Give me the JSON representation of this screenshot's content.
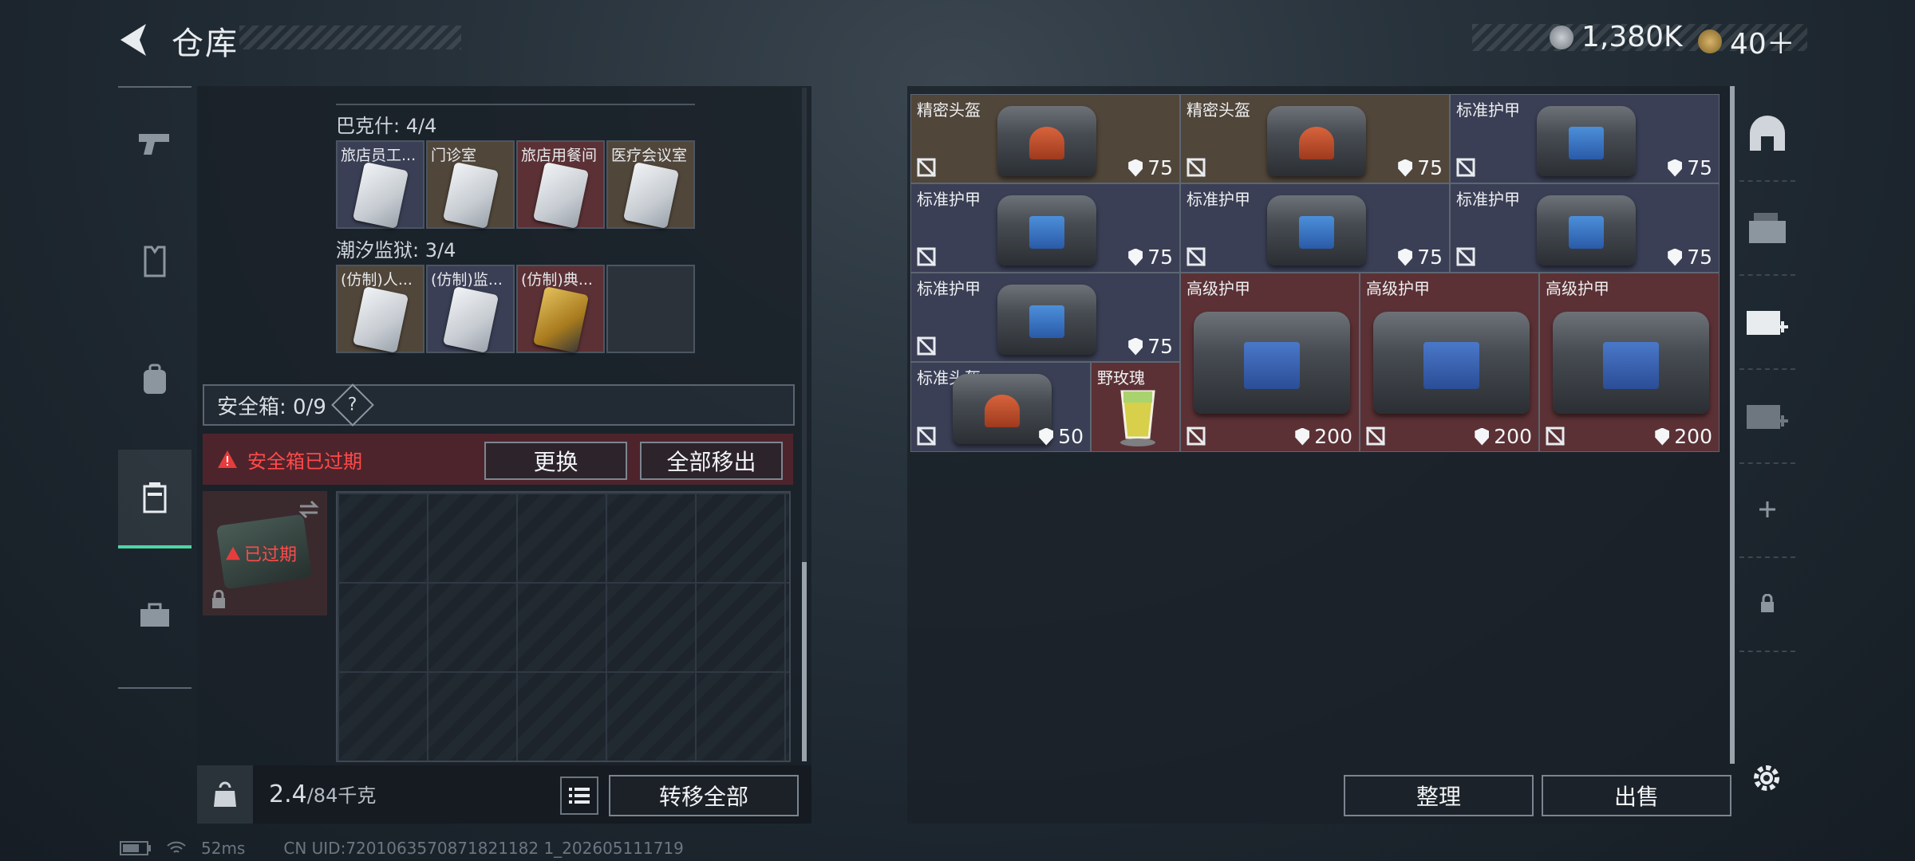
{
  "header": {
    "title": "仓库",
    "currency1": "1,380K",
    "currency2": "40＋"
  },
  "nav": {
    "items": [
      "weapons",
      "armor",
      "backpack",
      "safebox",
      "toolbox"
    ],
    "active": "safebox"
  },
  "collections": [
    {
      "title": "巴克什: 4/4",
      "slots": [
        {
          "label": "旅店员工...",
          "bg": "blue"
        },
        {
          "label": "门诊室",
          "bg": "brown"
        },
        {
          "label": "旅店用餐间",
          "bg": "red"
        },
        {
          "label": "医疗会议室",
          "bg": "brown"
        }
      ]
    },
    {
      "title": "潮汐监狱: 3/4",
      "slots": [
        {
          "label": "(仿制)人...",
          "bg": "brown"
        },
        {
          "label": "(仿制)监...",
          "bg": "blue"
        },
        {
          "label": "(仿制)典...",
          "bg": "red"
        },
        {
          "label": "",
          "bg": "dark"
        }
      ]
    }
  ],
  "safebox": {
    "label": "安全箱: 0/9",
    "help": "?",
    "expired_msg": "安全箱已过期",
    "replace_btn": "更换",
    "remove_all_btn": "全部移出",
    "item_expired": "已过期"
  },
  "weight": {
    "current": "2.4",
    "max": "/84千克",
    "transfer_all": "转移全部"
  },
  "inventory": [
    {
      "name": "精密头盔",
      "durability": "75"
    },
    {
      "name": "精密头盔",
      "durability": "75"
    },
    {
      "name": "标准护甲",
      "durability": "75"
    },
    {
      "name": "标准护甲",
      "durability": "75"
    },
    {
      "name": "标准护甲",
      "durability": "75"
    },
    {
      "name": "标准护甲",
      "durability": "75"
    },
    {
      "name": "标准护甲",
      "durability": "75"
    },
    {
      "name": "高级护甲",
      "durability": "200"
    },
    {
      "name": "高级护甲",
      "durability": "200"
    },
    {
      "name": "高级护甲",
      "durability": "200"
    },
    {
      "name": "标准头盔",
      "durability": "50"
    },
    {
      "name": "野玫瑰",
      "durability": ""
    }
  ],
  "actions": {
    "sort": "整理",
    "sell": "出售"
  },
  "footer": {
    "ping": "52ms",
    "uid": "CN UID:7201063570871821182 1_202605111719"
  }
}
